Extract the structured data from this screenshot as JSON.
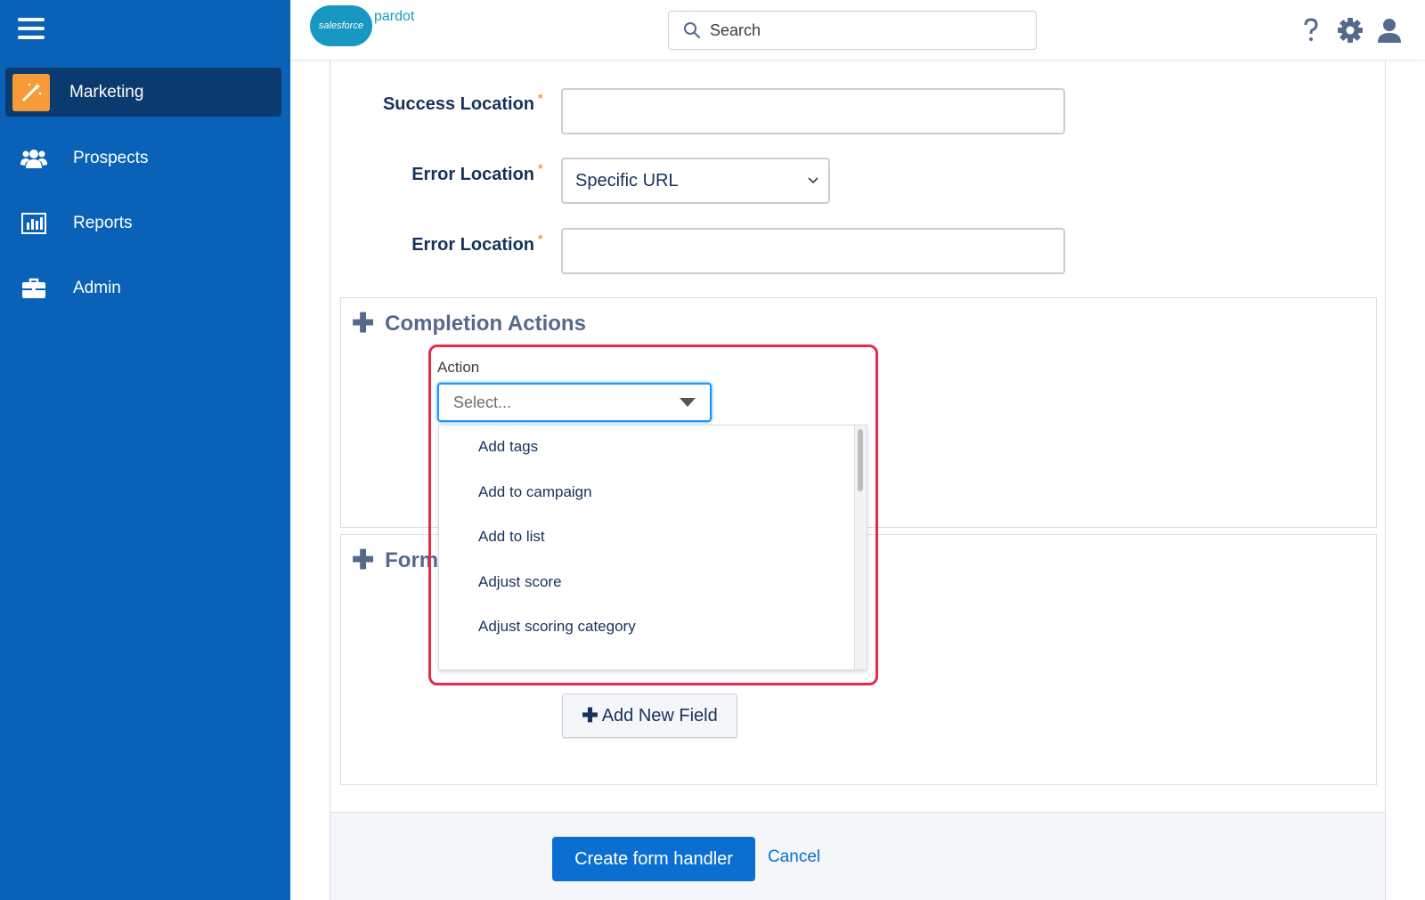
{
  "brand": {
    "cloud_text": "salesforce",
    "product": "pardot"
  },
  "search": {
    "placeholder": "Search"
  },
  "sidebar": {
    "items": [
      {
        "label": "Marketing",
        "icon": "magic-wand-icon",
        "active": true
      },
      {
        "label": "Prospects",
        "icon": "people-icon",
        "active": false
      },
      {
        "label": "Reports",
        "icon": "bar-chart-icon",
        "active": false
      },
      {
        "label": "Admin",
        "icon": "briefcase-icon",
        "active": false
      }
    ]
  },
  "form": {
    "success_location_label": "Success Location",
    "error_location_label": "Error Location",
    "error_location_select_value": "Specific URL",
    "error_location_url_label": "Error Location",
    "required_mark": "*"
  },
  "completion_actions": {
    "title": "Completion Actions",
    "action_label": "Action",
    "action_placeholder": "Select...",
    "options": [
      "Add tags",
      "Add to campaign",
      "Add to list",
      "Adjust score",
      "Adjust scoring category"
    ]
  },
  "form_fields": {
    "title": "Form",
    "add_new_field": "Add New Field"
  },
  "footer": {
    "create_label": "Create form handler",
    "cancel_label": "Cancel"
  },
  "colors": {
    "sidebar": "#0a62b8",
    "accent": "#0a6fd1",
    "highlight": "#e8294a",
    "active_icon": "#f59b38"
  }
}
